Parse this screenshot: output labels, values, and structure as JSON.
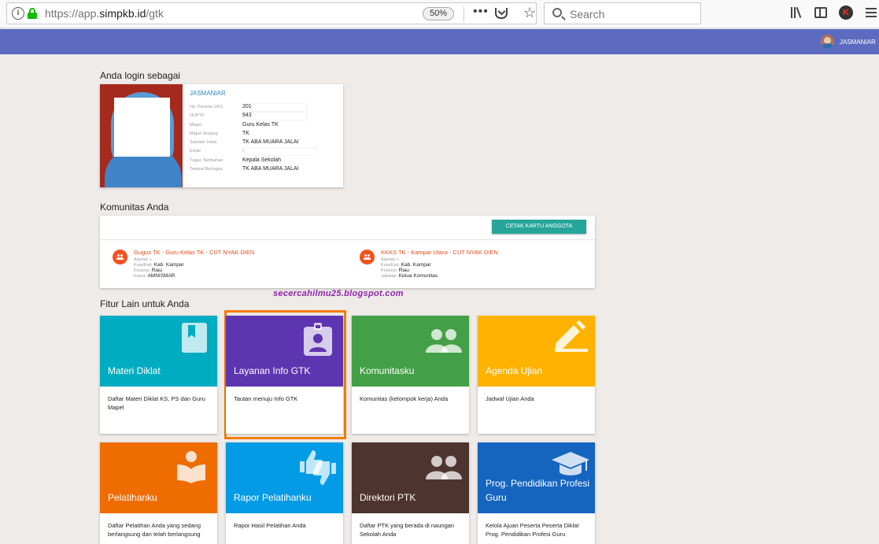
{
  "browser": {
    "info_icon": "info-icon",
    "url_prefix": "https://app.",
    "url_domain": "simpkb.id",
    "url_path": "/gtk",
    "zoom": "50%",
    "more_label": "•••",
    "star_glyph": "☆",
    "search_placeholder": "Search",
    "profile_letter": "K"
  },
  "header": {
    "username": "JASMANIAR",
    "color": "#5c6bc0"
  },
  "login": {
    "title": "Anda login sebagai",
    "name": "JASMANIAR",
    "fields": [
      {
        "label": "No. Peserta UKG",
        "value": "201"
      },
      {
        "label": "NUPTK",
        "value": "943"
      },
      {
        "label": "Mapel",
        "value": "Guru Kelas TK"
      },
      {
        "label": "Mapel Jenjang",
        "value": "TK"
      },
      {
        "label": "Sekolah Induk",
        "value": "TK ABA MUARA JALAI"
      },
      {
        "label": "Email",
        "value": ":"
      },
      {
        "label": "Tugas Tambahan",
        "value": "Kepala Sekolah"
      },
      {
        "label": "Tempat Bertugas",
        "value": "TK ABA MUARA JALAI"
      }
    ]
  },
  "community": {
    "title": "Komunitas Anda",
    "print_button": "CETAK KARTU ANGGOTA",
    "items": [
      {
        "title": "Gugus TK - Guru Kelas TK - CUT NYAK DIEN",
        "lines": [
          {
            "label": "Alamat:",
            "value": "-"
          },
          {
            "label": "Kota/Kab:",
            "value": "Kab. Kampar"
          },
          {
            "label": "Provinsi:",
            "value": "Riau"
          },
          {
            "label": "Ketua:",
            "value": "AMNISMAR"
          }
        ]
      },
      {
        "title": "KKKS TK - Kampar Utara - CUT NYAK DIEN",
        "lines": [
          {
            "label": "Alamat:",
            "value": "-"
          },
          {
            "label": "Kota/Kab:",
            "value": "Kab. Kampar"
          },
          {
            "label": "Provinsi:",
            "value": "Riau"
          },
          {
            "label": "Jabatan:",
            "value": "Ketua Komunitas"
          }
        ]
      }
    ]
  },
  "watermark": "secercahilmu25.blogspot.com",
  "features": {
    "title": "Fitur Lain untuk Anda",
    "tiles": [
      {
        "title": "Materi Diklat",
        "desc": "Daftar Materi Diklat KS, PS dan Guru Mapel",
        "color": "#00acc1",
        "icon": "book-icon"
      },
      {
        "title": "Layanan Info GTK",
        "desc": "Tautan menuju Info GTK",
        "color": "#5e35b1",
        "icon": "id-badge-icon"
      },
      {
        "title": "Komunitasku",
        "desc": "Komunitas (kelompok kerja) Anda",
        "color": "#43a047",
        "icon": "people-icon"
      },
      {
        "title": "Agenda Ujian",
        "desc": "Jadwal Ujian Anda",
        "color": "#ffb300",
        "icon": "pencil-icon"
      },
      {
        "title": "Pelatihanku",
        "desc": "Daftar Pelatihan Anda yang sedang berlangsung dan telah berlangsung",
        "color": "#ef6c00",
        "icon": "reader-icon"
      },
      {
        "title": "Rapor Pelatihanku",
        "desc": "Rapor Hasil Pelatihan Anda",
        "color": "#039be5",
        "icon": "thumbs-icon"
      },
      {
        "title": "Direktori PTK",
        "desc": "Daftar PTK yang berada di naungan Sekolah Anda",
        "color": "#4e342e",
        "icon": "people-icon"
      },
      {
        "title": "Prog. Pendidikan Profesi Guru",
        "desc": "Kelola Ajuan Peserta Peserta Diklat Prog. Pendidikan Profesi Guru",
        "color": "#1565c0",
        "icon": "graduation-cap-icon"
      }
    ]
  }
}
